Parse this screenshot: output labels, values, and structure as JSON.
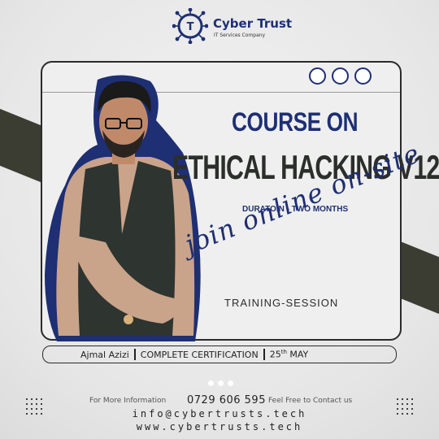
{
  "brand": {
    "name": "Cyber Trust",
    "tagline": "IT Services Company",
    "logo_icon": "circuit-t-logo",
    "color": "#1e2f73"
  },
  "headline": {
    "line1": "COURSE ON",
    "line2": "ETHICAL HACKING V12",
    "duration": "DURATOIN - TWO MONTHS"
  },
  "mode": {
    "script": "join online on-site",
    "training": "TRAINING-SESSION"
  },
  "info_bar": {
    "instructor": "Ajmal Azizi",
    "certification": "COMPLETE CERTIFICATION",
    "date_day": "25",
    "date_suffix": "th",
    "date_month": "MAY"
  },
  "contact": {
    "more_info": "For More Information",
    "phone": "0729 606 595",
    "free": "Feel Free to Contact us",
    "email": "info@cybertrusts.tech",
    "website": "www.cybertrusts.tech"
  },
  "colors": {
    "accent": "#1e2f73",
    "dark": "#3b3d33"
  }
}
